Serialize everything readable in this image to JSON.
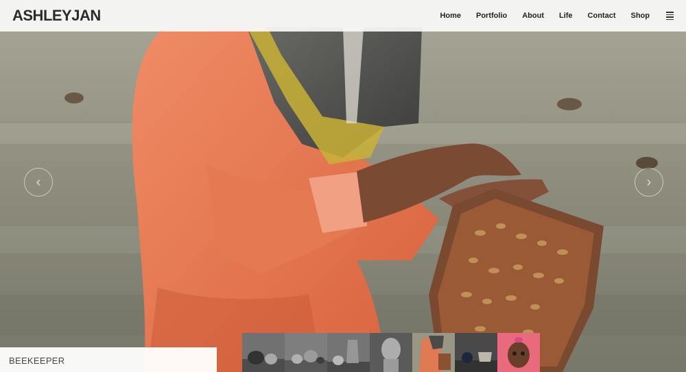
{
  "header": {
    "logo": "ASHLEYJAN",
    "nav": [
      {
        "label": "Home"
      },
      {
        "label": "Portfolio"
      },
      {
        "label": "About"
      },
      {
        "label": "Life"
      },
      {
        "label": "Contact"
      },
      {
        "label": "Shop"
      }
    ],
    "menu_icon": "hamburger-icon"
  },
  "slider": {
    "prev_icon": "chevron-left-icon",
    "next_icon": "chevron-right-icon",
    "prev_glyph": "‹",
    "next_glyph": "›",
    "caption": "BEEKEEPER"
  },
  "thumbnails": [
    {
      "name": "still-life-pumpkin"
    },
    {
      "name": "still-life-fruit"
    },
    {
      "name": "still-life-jug"
    },
    {
      "name": "classical-bust"
    },
    {
      "name": "beekeeper"
    },
    {
      "name": "still-life-cup"
    },
    {
      "name": "child-portrait"
    }
  ],
  "colors": {
    "suit_orange": "#e07a52",
    "veil_yellow": "#c8b23a",
    "background": "#8f8f82"
  }
}
